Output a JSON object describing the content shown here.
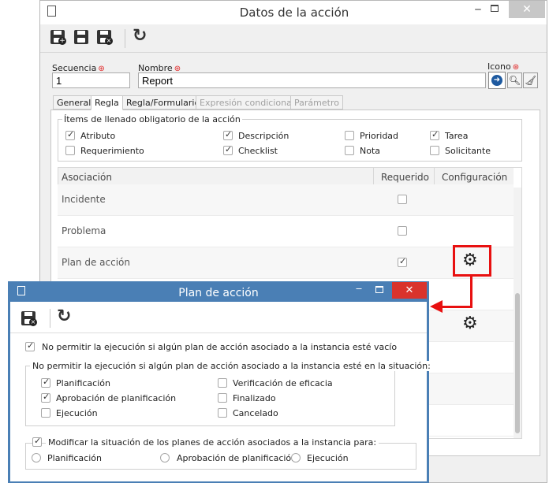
{
  "main_window": {
    "title": "Datos de la acción",
    "fields": {
      "secuencia_label": "Secuencia",
      "secuencia_value": "1",
      "nombre_label": "Nombre",
      "nombre_value": "Report",
      "icono_label": "Icono"
    },
    "tabs": [
      {
        "label": "General",
        "state": "normal"
      },
      {
        "label": "Regla",
        "state": "active"
      },
      {
        "label": "Regla/Formulario",
        "state": "normal"
      },
      {
        "label": "Expresión condicional",
        "state": "disabled"
      },
      {
        "label": "Parámetro",
        "state": "disabled"
      }
    ],
    "items_group": {
      "legend": "Ítems de llenado obligatorio de la acción",
      "items": [
        {
          "label": "Atributo",
          "checked": true
        },
        {
          "label": "Descripción",
          "checked": true
        },
        {
          "label": "Prioridad",
          "checked": false
        },
        {
          "label": "Tarea",
          "checked": true
        },
        {
          "label": "Requerimiento",
          "checked": false
        },
        {
          "label": "Checklist",
          "checked": true
        },
        {
          "label": "Nota",
          "checked": false
        },
        {
          "label": "Solicitante",
          "checked": false
        }
      ]
    },
    "table": {
      "headers": {
        "asociacion": "Asociación",
        "requerido": "Requerido",
        "configuracion": "Configuración"
      },
      "rows": [
        {
          "asociacion": "Incidente",
          "requerido": false,
          "config": false
        },
        {
          "asociacion": "Problema",
          "requerido": false,
          "config": false
        },
        {
          "asociacion": "Plan de acción",
          "requerido": true,
          "config": true
        },
        {
          "asociacion": "",
          "requerido": false,
          "config": true
        }
      ]
    }
  },
  "dialog": {
    "title": "Plan de acción",
    "option_empty": {
      "label": "No permitir la ejecución si algún plan de acción asociado a la instancia esté vacío",
      "checked": true
    },
    "situation_group": {
      "legend": "No permitir la ejecución si algún plan de acción asociado a la instancia esté en la situación:",
      "items": [
        {
          "label": "Planificación",
          "checked": true
        },
        {
          "label": "Verificación de eficacia",
          "checked": false
        },
        {
          "label": "Aprobación de planificación",
          "checked": true
        },
        {
          "label": "Finalizado",
          "checked": false
        },
        {
          "label": "Ejecución",
          "checked": false
        },
        {
          "label": "Cancelado",
          "checked": false
        }
      ]
    },
    "modify_group": {
      "legend": "Modificar la situación de los planes de acción asociados a la instancia para:",
      "checked": true,
      "radios": [
        {
          "label": "Planificación"
        },
        {
          "label": "Aprobación de planificación"
        },
        {
          "label": "Ejecución"
        }
      ]
    }
  },
  "colors": {
    "accent": "#3c78b4",
    "close_red": "#d9332c",
    "highlight": "#e81010"
  }
}
